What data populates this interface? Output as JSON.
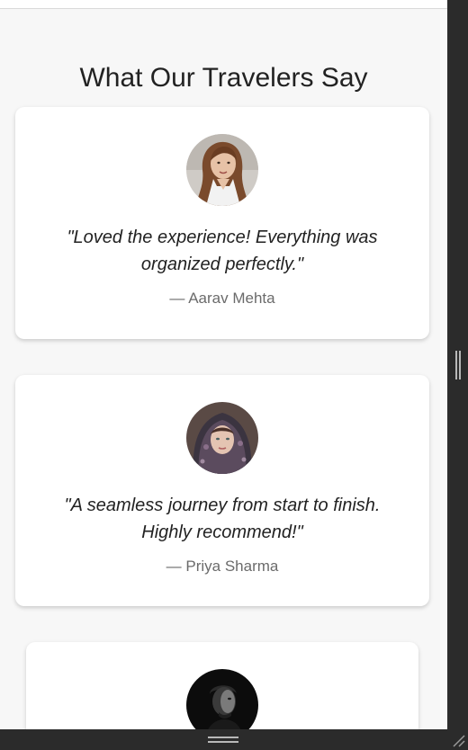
{
  "section": {
    "title": "What Our Travelers Say"
  },
  "testimonials": [
    {
      "quote": "\"Loved the experience! Everything was organized perfectly.\"",
      "author": "— Aarav Mehta",
      "avatar_icon": "woman-portrait"
    },
    {
      "quote": "\"A seamless journey from start to finish. Highly recommend!\"",
      "author": "— Priya Sharma",
      "avatar_icon": "woman-headscarf-portrait"
    },
    {
      "avatar_icon": "man-portrait-dark"
    }
  ],
  "colors": {
    "page_bg": "#f7f7f7",
    "card_bg": "#ffffff",
    "title_text": "#222222",
    "author_text": "#6b6b6b",
    "chrome_bg": "#2b2b2b"
  }
}
